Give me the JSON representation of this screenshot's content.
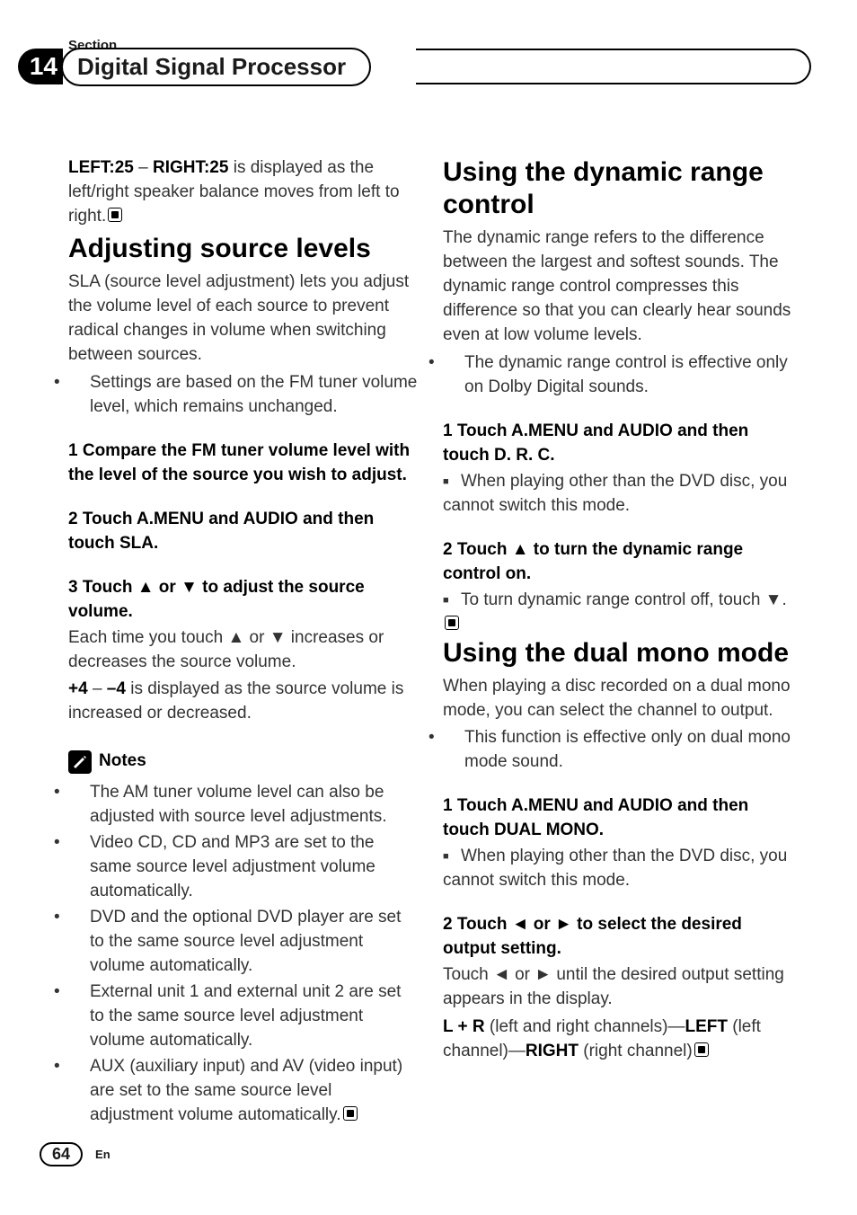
{
  "section_label": "Section",
  "section_number": "14",
  "chapter_title": "Digital Signal Processor",
  "left_col": {
    "intro_html": "<b>LEFT:25</b> – <b>RIGHT:25</b> is displayed as the left/right speaker balance moves from left to right.",
    "h2_1": "Adjusting source levels",
    "p_sla_intro": "SLA (source level adjustment) lets you adjust the volume level of each source to prevent radical changes in volume when switching between sources.",
    "sla_bullets": [
      "Settings are based on the FM tuner volume level, which remains unchanged."
    ],
    "step1_title": "1    Compare the FM tuner volume level with the level of the source you wish to adjust.",
    "step2_title": "2    Touch A.MENU and AUDIO and then touch SLA.",
    "step3_title_html": "3    Touch <span class='arrow'>▲</span> or <span class='arrow'>▼</span> to adjust the source volume.",
    "step3_body_html": "Each time you touch <span class='arrow'>▲</span> or <span class='arrow'>▼</span> increases or decreases the source volume.",
    "step3_body2_html": "<b>+4</b> – <b>–4</b> is displayed as the source volume is increased or decreased.",
    "notes_label": "Notes",
    "notes": [
      "The AM tuner volume level can also be adjusted with source level adjustments.",
      "Video CD, CD and MP3 are set to the same source level adjustment volume automatically.",
      "DVD and the optional DVD player are set to the same source level adjustment volume automatically.",
      "External unit 1 and external unit 2 are set to the same source level adjustment volume automatically.",
      "AUX (auxiliary input) and AV (video input) are set to the same source level adjustment volume automatically."
    ]
  },
  "right_col": {
    "h2_1": "Using the dynamic range control",
    "drc_intro": "The dynamic range refers to the difference between the largest and softest sounds. The dynamic range control compresses this difference so that you can clearly hear sounds even at low volume levels.",
    "drc_bullets": [
      "The dynamic range control is effective only on Dolby Digital sounds."
    ],
    "drc_step1_title": "1    Touch A.MENU and AUDIO and then touch D. R. C.",
    "drc_step1_sub": "When playing other than the DVD disc, you cannot switch this mode.",
    "drc_step2_title_html": "2    Touch <span class='arrow'>▲</span> to turn the dynamic range control on.",
    "drc_step2_sub_html": "To turn dynamic range control off, touch <span class='arrow'>▼</span>.",
    "h2_2": "Using the dual mono mode",
    "dm_intro": "When playing a disc recorded on a dual mono mode, you can select the channel to output.",
    "dm_bullets": [
      "This function is effective only on dual mono mode sound."
    ],
    "dm_step1_title": "1    Touch A.MENU and AUDIO and then touch DUAL MONO.",
    "dm_step1_sub": "When playing other than the DVD disc, you cannot switch this mode.",
    "dm_step2_title_html": "2    Touch <span class='arrow'>◄</span> or <span class='arrow'>►</span> to select the desired output setting.",
    "dm_step2_body_html": "Touch <span class='arrow'>◄</span> or <span class='arrow'>►</span> until the desired output setting appears in the display.",
    "dm_step2_body2_html": "<b>L + R</b> (left and right channels)—<b>LEFT</b> (left channel)—<b>RIGHT</b> (right channel)"
  },
  "footer": {
    "page_number": "64",
    "lang": "En"
  }
}
